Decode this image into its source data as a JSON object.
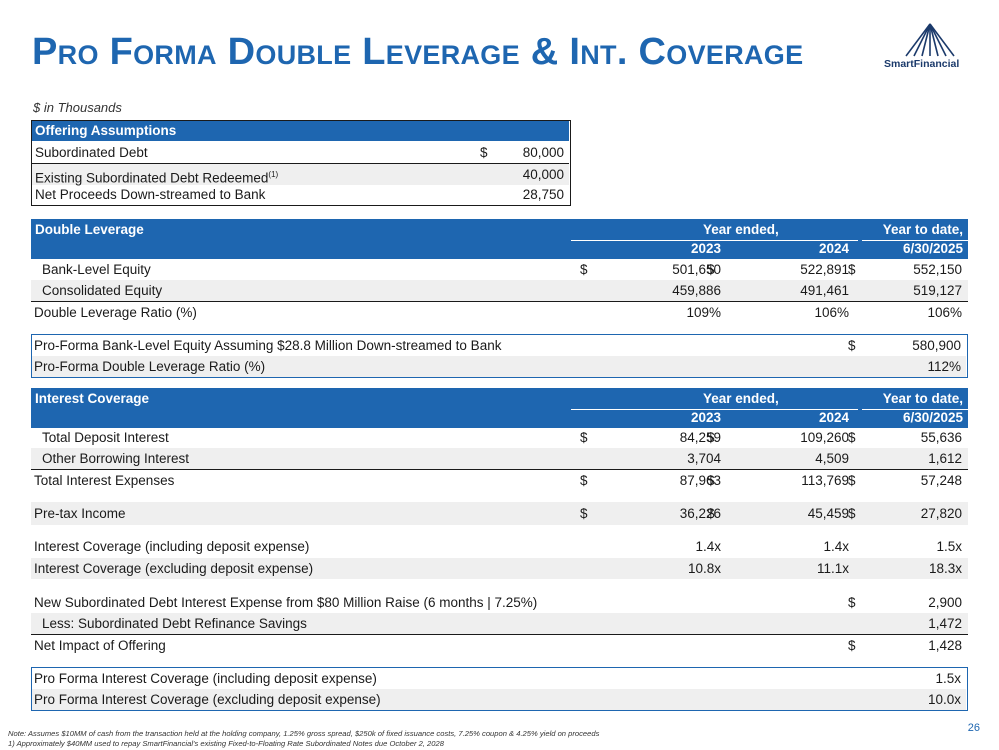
{
  "title": "Pro Forma Double Leverage & Int. Coverage",
  "logo_text": "SmartFinancial",
  "units": "$ in Thousands",
  "offering": {
    "header": "Offering Assumptions",
    "rows": [
      {
        "label": "Subordinated Debt",
        "dollar": "$",
        "value": "80,000"
      },
      {
        "label": "Existing Subordinated Debt Redeemed",
        "sup": "(1)",
        "dollar": "",
        "value": "40,000"
      },
      {
        "label": "Net Proceeds Down-streamed to Bank",
        "dollar": "",
        "value": "28,750"
      }
    ]
  },
  "double_leverage": {
    "header": "Double Leverage",
    "year_ended": "Year ended,",
    "year_to_date": "Year to date,",
    "col1": "2023",
    "col2": "2024",
    "col3": "6/30/2025",
    "rows": [
      {
        "label": "Bank-Level Equity",
        "d1": "$",
        "v1": "501,650",
        "d2": "$",
        "v2": "522,891",
        "d3": "$",
        "v3": "552,150"
      },
      {
        "label": "Consolidated Equity",
        "d1": "",
        "v1": "459,886",
        "d2": "",
        "v2": "491,461",
        "d3": "",
        "v3": "519,127"
      },
      {
        "label": "Double Leverage Ratio (%)",
        "d1": "",
        "v1": "109%",
        "d2": "",
        "v2": "106%",
        "d3": "",
        "v3": "106%"
      }
    ],
    "pro_forma": [
      {
        "label": "Pro-Forma Bank-Level Equity Assuming $28.8 Million Down-streamed to Bank",
        "d3": "$",
        "v3": "580,900"
      },
      {
        "label": "Pro-Forma Double Leverage Ratio (%)",
        "d3": "",
        "v3": "112%"
      }
    ]
  },
  "interest_coverage": {
    "header": "Interest Coverage",
    "year_ended": "Year ended,",
    "year_to_date": "Year to date,",
    "col1": "2023",
    "col2": "2024",
    "col3": "6/30/2025",
    "rows": [
      {
        "label": "Total Deposit Interest",
        "d1": "$",
        "v1": "84,259",
        "d2": "$",
        "v2": "109,260",
        "d3": "$",
        "v3": "55,636"
      },
      {
        "label": "Other Borrowing Interest",
        "d1": "",
        "v1": "3,704",
        "d2": "",
        "v2": "4,509",
        "d3": "",
        "v3": "1,612"
      },
      {
        "label": "Total Interest Expenses",
        "d1": "$",
        "v1": "87,963",
        "d2": "$",
        "v2": "113,769",
        "d3": "$",
        "v3": "57,248"
      },
      {
        "label": "Pre-tax Income",
        "d1": "$",
        "v1": "36,226",
        "d2": "$",
        "v2": "45,459",
        "d3": "$",
        "v3": "27,820"
      },
      {
        "label": "Interest Coverage (including deposit expense)",
        "d1": "",
        "v1": "1.4x",
        "d2": "",
        "v2": "1.4x",
        "d3": "",
        "v3": "1.5x"
      },
      {
        "label": "Interest Coverage (excluding deposit expense)",
        "d1": "",
        "v1": "10.8x",
        "d2": "",
        "v2": "11.1x",
        "d3": "",
        "v3": "18.3x"
      },
      {
        "label": "New Subordinated Debt Interest Expense from $80 Million Raise (6 months | 7.25%)",
        "d3": "$",
        "v3": "2,900"
      },
      {
        "label": "Less: Subordinated Debt Refinance Savings",
        "d3": "",
        "v3": "1,472"
      },
      {
        "label": "Net Impact of Offering",
        "d3": "$",
        "v3": "1,428"
      }
    ],
    "pro_forma": [
      {
        "label": "Pro Forma Interest Coverage (including deposit expense)",
        "v3": "1.5x"
      },
      {
        "label": "Pro Forma Interest Coverage (excluding deposit expense)",
        "v3": "10.0x"
      }
    ]
  },
  "footnotes": {
    "note": "Note: Assumes $10MM of cash from the transaction held at the holding company, 1.25% gross spread, $250k of fixed issuance costs, 7.25% coupon & 4.25% yield on proceeds",
    "fn1": "1)      Approximately $40MM used to repay SmartFinancial's existing Fixed-to-Floating Rate Subordinated Notes due October 2, 2028"
  },
  "page_number": "26",
  "colors": {
    "accent": "#1e66b0",
    "shade": "#efefef"
  }
}
